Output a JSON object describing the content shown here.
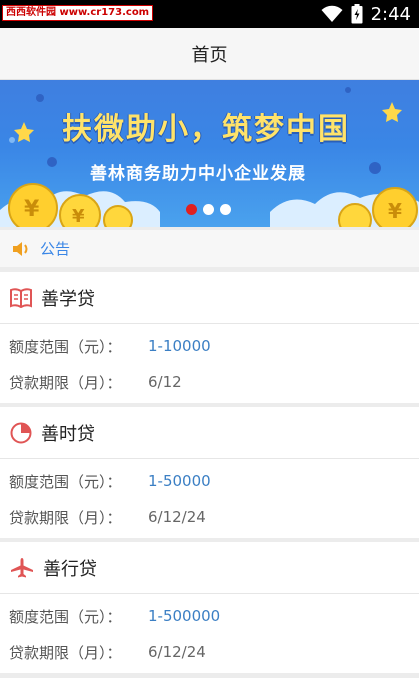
{
  "status_bar": {
    "watermark": "西西软件园 www.cr173.com",
    "time": "2:44"
  },
  "header": {
    "title": "首页"
  },
  "banner": {
    "headline": "扶微助小，筑梦中国",
    "subline": "善林商务助力中小企业发展",
    "dots": 3,
    "active_dot": 0,
    "colors": {
      "active_dot": "#e02020",
      "dot": "#ffffff",
      "headline": "#ffe36a"
    }
  },
  "notice": {
    "icon": "speaker-icon",
    "label": "公告"
  },
  "products": [
    {
      "name": "善学贷",
      "icon": "book-icon",
      "amount_label": "额度范围（元）：",
      "amount": "1-10000",
      "term_label": "贷款期限（月）：",
      "term": "6/12"
    },
    {
      "name": "善时贷",
      "icon": "pie-clock-icon",
      "amount_label": "额度范围（元）：",
      "amount": "1-50000",
      "term_label": "贷款期限（月）：",
      "term": "6/12/24"
    },
    {
      "name": "善行贷",
      "icon": "airplane-icon",
      "amount_label": "额度范围（元）：",
      "amount": "1-500000",
      "term_label": "贷款期限（月）：",
      "term": "6/12/24"
    }
  ],
  "theme": {
    "accent": "#3a86e6",
    "icon_red": "#e05555",
    "value_blue": "#3b7fc4"
  }
}
